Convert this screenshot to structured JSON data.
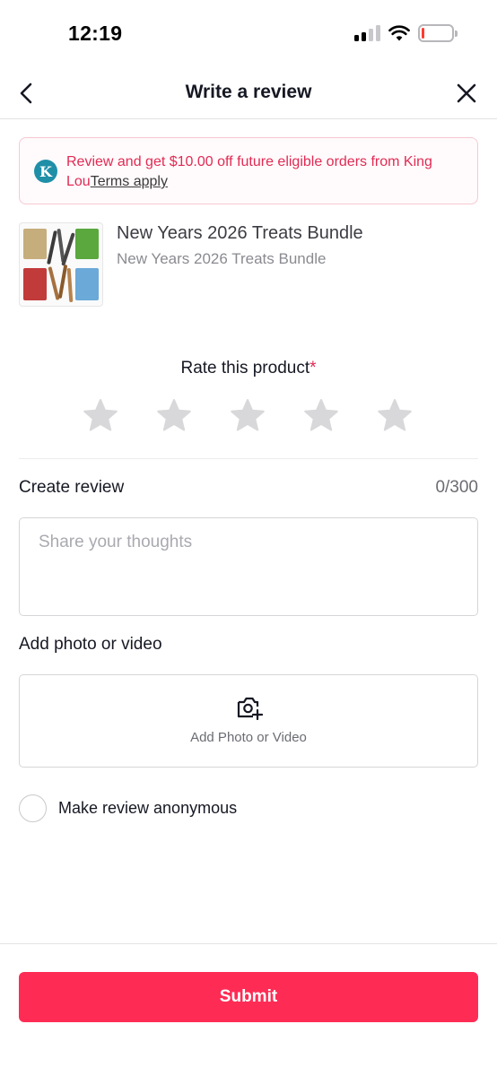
{
  "status_bar": {
    "time": "12:19",
    "icons": [
      "cellular-signal-icon",
      "wifi-icon",
      "battery-icon"
    ],
    "battery_color": "#ff3b30"
  },
  "nav": {
    "title": "Write a review",
    "back_icon": "chevron-left-icon",
    "close_icon": "close-icon"
  },
  "promo": {
    "logo_letter": "K",
    "text": "Review and get $10.00 off future eligible orders from King Lou",
    "terms_label": "Terms apply",
    "accent_color": "#e12b54"
  },
  "product": {
    "title": "New Years 2026 Treats Bundle",
    "variant": "New Years 2026 Treats Bundle"
  },
  "rating": {
    "label": "Rate this product",
    "required_marker": "*",
    "max_stars": 5,
    "selected": 0
  },
  "review": {
    "label": "Create review",
    "counter": "0/300",
    "value": "",
    "placeholder": "Share your thoughts"
  },
  "media": {
    "label": "Add photo or video",
    "button_label": "Add Photo or Video",
    "icon": "camera-add-icon"
  },
  "anonymous": {
    "label": "Make review anonymous",
    "checked": false
  },
  "submit": {
    "label": "Submit",
    "color": "#fe2c55"
  }
}
